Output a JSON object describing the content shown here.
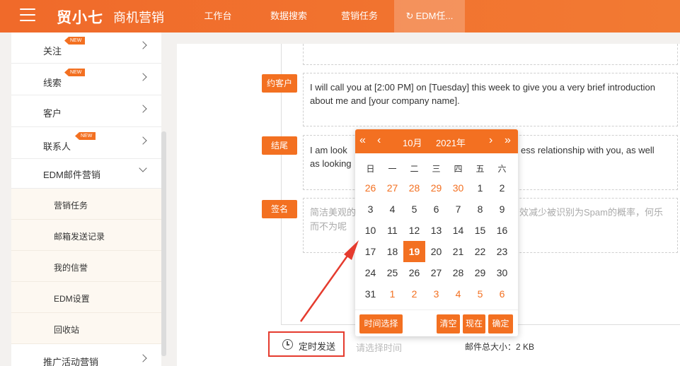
{
  "topbar": {
    "logo": "贸小七",
    "brand": "商机营销",
    "nav": [
      {
        "label": "工作台"
      },
      {
        "label": "数据搜索"
      },
      {
        "label": "营销任务"
      },
      {
        "label": "EDM任..."
      }
    ],
    "active_icon": "↻"
  },
  "sidebar": {
    "items": [
      {
        "label": "关注",
        "badge": "NEW"
      },
      {
        "label": "线索",
        "badge": "NEW"
      },
      {
        "label": "客户"
      },
      {
        "label": "联系人",
        "badge": "NEW"
      },
      {
        "label": "EDM邮件营销"
      },
      {
        "label": "推广活动营销"
      }
    ],
    "sub_items": [
      {
        "label": "营销任务"
      },
      {
        "label": "邮箱发送记录"
      },
      {
        "label": "我的信誉"
      },
      {
        "label": "EDM设置"
      },
      {
        "label": "回收站"
      }
    ]
  },
  "editor": {
    "blocks": [
      {
        "tag": "约客户",
        "text": "I will call you at [2:00 PM] on [Tuesday] this week to give you a very brief introduction about me and [your company name]."
      },
      {
        "tag": "结尾",
        "text_left": "I am look",
        "text_right": "ess relationship with you, as well",
        "text_left2": "as looking"
      },
      {
        "tag": "签名",
        "placeholder_left": "简洁美观的",
        "placeholder_right": "效减少被识别为Spam的概率，何乐",
        "placeholder_left2": "而不为呢"
      }
    ]
  },
  "bottom": {
    "timer_label": "定时发送",
    "time_placeholder": "请选择时间",
    "mail_size": "邮件总大小：2 KB"
  },
  "datepicker": {
    "prev_year": "«",
    "prev_month": "‹",
    "month": "10月",
    "year": "2021年",
    "next_month": "›",
    "next_year": "»",
    "weekdays": [
      "日",
      "一",
      "二",
      "三",
      "四",
      "五",
      "六"
    ],
    "weeks": [
      [
        "26",
        "27",
        "28",
        "29",
        "30",
        "1",
        "2"
      ],
      [
        "3",
        "4",
        "5",
        "6",
        "7",
        "8",
        "9"
      ],
      [
        "10",
        "11",
        "12",
        "13",
        "14",
        "15",
        "16"
      ],
      [
        "17",
        "18",
        "19",
        "20",
        "21",
        "22",
        "23"
      ],
      [
        "24",
        "25",
        "26",
        "27",
        "28",
        "29",
        "30"
      ],
      [
        "31",
        "1",
        "2",
        "3",
        "4",
        "5",
        "6"
      ]
    ],
    "selected": "19",
    "buttons": {
      "time_select": "时间选择",
      "clear": "清空",
      "now": "现在",
      "confirm": "确定"
    }
  },
  "colors": {
    "accent": "#f37021",
    "highlight": "#e53b2e"
  }
}
